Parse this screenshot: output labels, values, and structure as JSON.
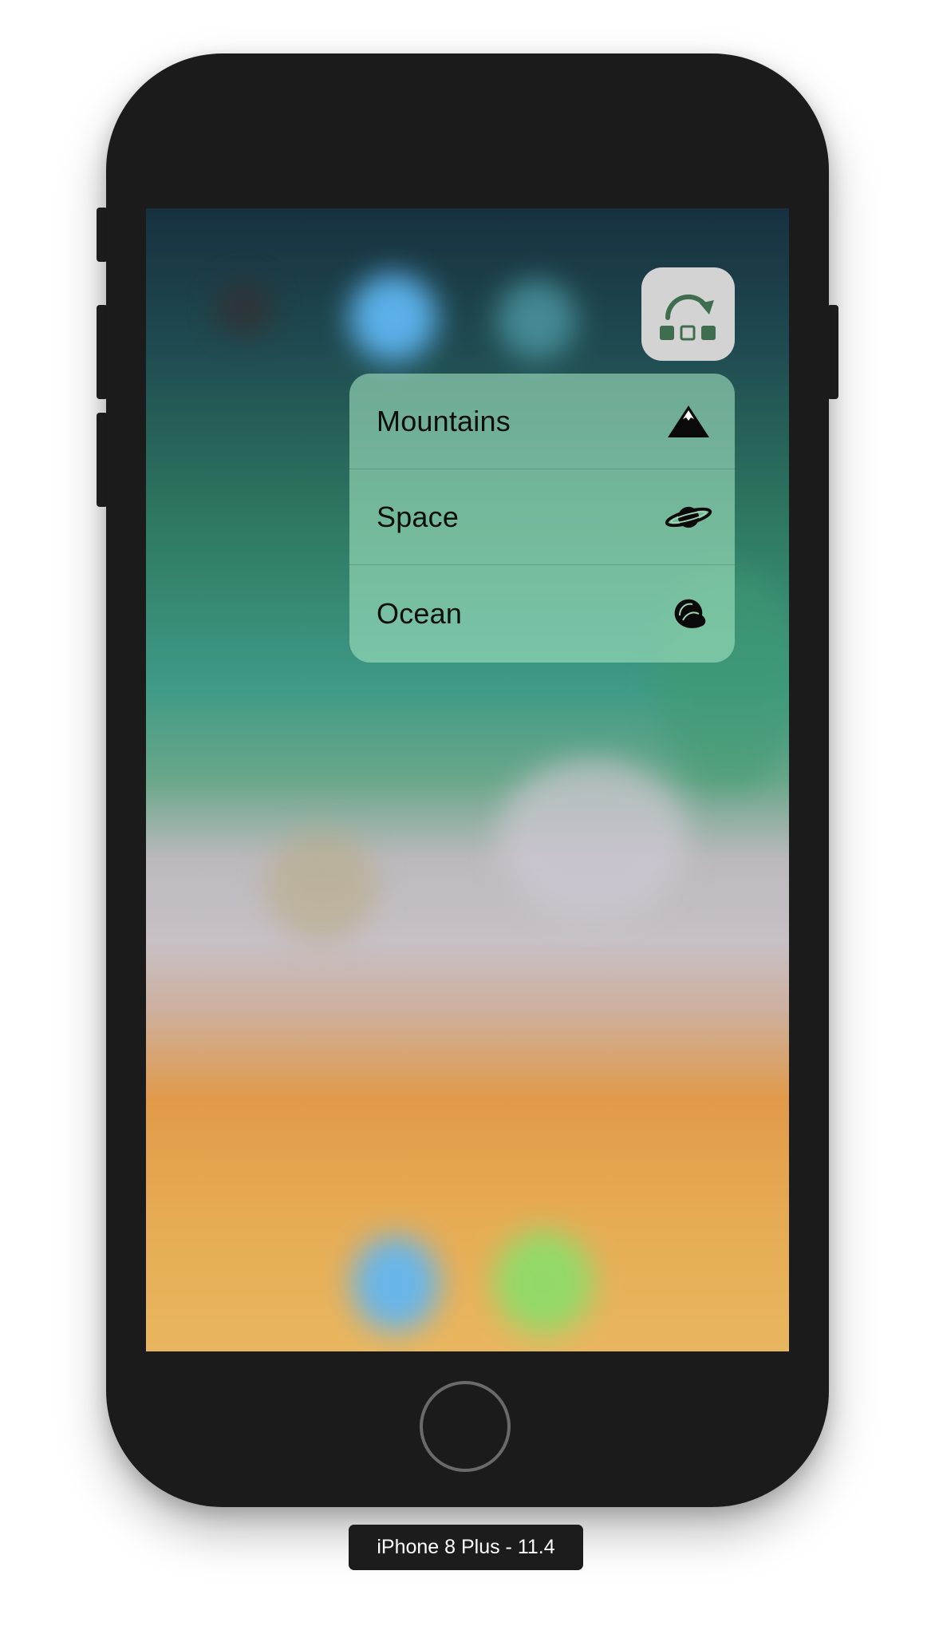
{
  "device": {
    "label": "iPhone 8 Plus - 11.4"
  },
  "home_screen": {
    "app_icon": {
      "icon": "rotate-arrow-squares-icon"
    }
  },
  "quick_actions": {
    "items": [
      {
        "label": "Mountains",
        "icon": "mountain-icon"
      },
      {
        "label": "Space",
        "icon": "planet-icon"
      },
      {
        "label": "Ocean",
        "icon": "seashell-icon"
      }
    ]
  },
  "colors": {
    "bezel": "#1b1b1b",
    "menu_tint": "#a0e1be",
    "icon_glyph": "#3f6d4f",
    "app_icon_bg": "#d3d3d3"
  }
}
